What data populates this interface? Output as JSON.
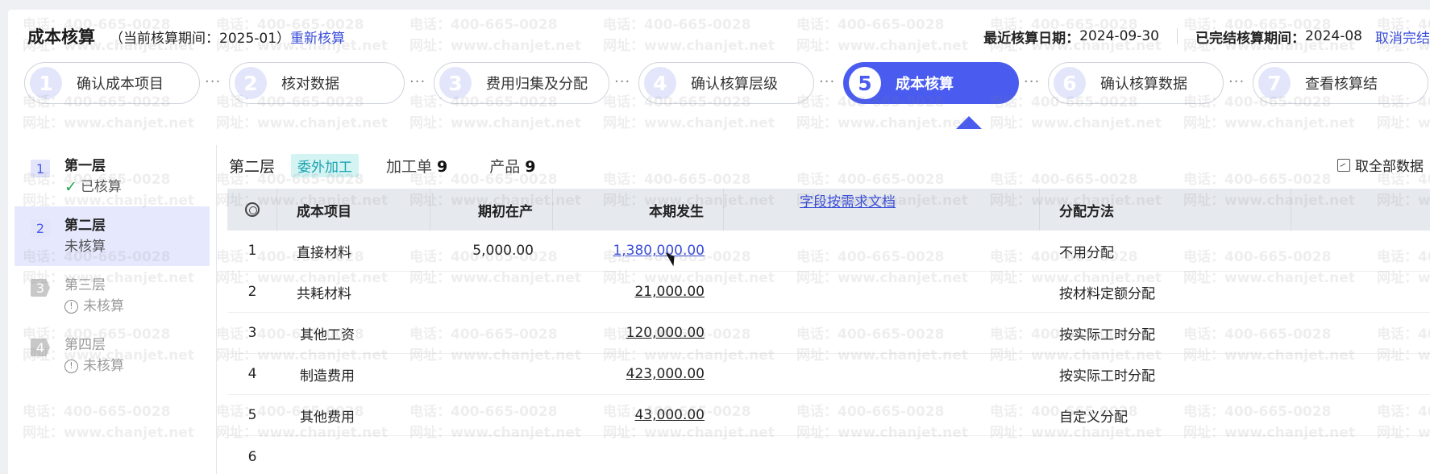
{
  "header": {
    "title": "成本核算",
    "period_text": "（当前核算期间：2025-01）",
    "recalc_link": "重新核算",
    "last_date_label": "最近核算日期：",
    "last_date_value": "2024-09-30",
    "closed_label": "已完结核算期间：",
    "closed_value": "2024-08",
    "cancel_link": "取消完结"
  },
  "steps": [
    {
      "num": "1",
      "label": "确认成本项目"
    },
    {
      "num": "2",
      "label": "核对数据"
    },
    {
      "num": "3",
      "label": "费用归集及分配"
    },
    {
      "num": "4",
      "label": "确认核算层级"
    },
    {
      "num": "5",
      "label": "成本核算",
      "active": true
    },
    {
      "num": "6",
      "label": "确认核算数据"
    },
    {
      "num": "7",
      "label": "查看核算结"
    }
  ],
  "levels": [
    {
      "num": "1",
      "name": "第一层",
      "status": "已核算",
      "icon": "check-icon"
    },
    {
      "num": "2",
      "name": "第二层",
      "status": "未核算",
      "selected": true
    },
    {
      "num": "3",
      "name": "第三层",
      "status": "未核算",
      "icon": "warning-icon"
    },
    {
      "num": "4",
      "name": "第四层",
      "status": "未核算",
      "icon": "warning-icon"
    }
  ],
  "toolbar": {
    "layer": "第二层",
    "tag": "委外加工",
    "orders_label": "加工单",
    "orders_count": "9",
    "products_label": "产品",
    "products_count": "9",
    "fetch_label": "取全部数据"
  },
  "table": {
    "headers": [
      "成本项目",
      "期初在产",
      "本期发生",
      "",
      "分配方法"
    ],
    "doc_link": "字段按需求文档",
    "rows": [
      {
        "idx": "1",
        "item": "直接材料",
        "opening": "5,000.00",
        "current": "1,380,000.00",
        "method": "不用分配"
      },
      {
        "idx": "2",
        "item": "共耗材料",
        "opening": "",
        "current": "21,000.00",
        "method": "按材料定额分配"
      },
      {
        "idx": "3",
        "item": "其他工资",
        "opening": "",
        "current": "120,000.00",
        "method": "按实际工时分配"
      },
      {
        "idx": "4",
        "item": "制造费用",
        "opening": "",
        "current": "423,000.00",
        "method": "按实际工时分配"
      },
      {
        "idx": "5",
        "item": "其他费用",
        "opening": "",
        "current": "43,000.00",
        "method": "自定义分配"
      },
      {
        "idx": "6",
        "item": "",
        "opening": "",
        "current": "",
        "method": ""
      }
    ]
  },
  "watermark": {
    "line1": "电话：400-665-0028",
    "line2": "网址：www.chanjet.net"
  },
  "colors": {
    "accent": "#4a5cf0",
    "link": "#3a4ed8",
    "tag_bg": "#d4f3f3",
    "tag_fg": "#1aa3b0",
    "check": "#1fa64a"
  }
}
